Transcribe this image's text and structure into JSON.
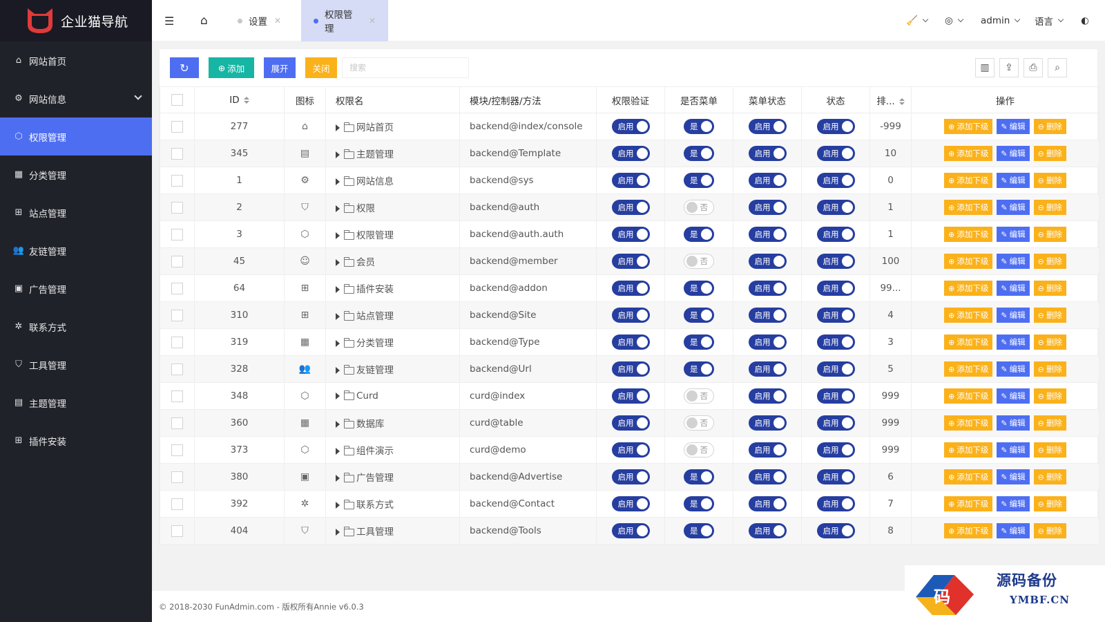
{
  "app": {
    "title": "企业猫导航"
  },
  "sidebar": {
    "items": [
      {
        "label": "网站首页",
        "icon": "home-icon",
        "glyph": "⌂"
      },
      {
        "label": "网站信息",
        "icon": "gear-icon",
        "glyph": "⚙",
        "expandable": true
      },
      {
        "label": "权限管理",
        "icon": "cube-icon",
        "glyph": "⬡",
        "active": true
      },
      {
        "label": "分类管理",
        "icon": "apps-icon",
        "glyph": "▦"
      },
      {
        "label": "站点管理",
        "icon": "windows-icon",
        "glyph": "⊞"
      },
      {
        "label": "友链管理",
        "icon": "users-icon",
        "glyph": "👥"
      },
      {
        "label": "广告管理",
        "icon": "picture-icon",
        "glyph": "▣"
      },
      {
        "label": "联系方式",
        "icon": "cog-outline-icon",
        "glyph": "✲"
      },
      {
        "label": "工具管理",
        "icon": "shield-icon",
        "glyph": "⛉"
      },
      {
        "label": "主题管理",
        "icon": "calendar-icon",
        "glyph": "▤"
      },
      {
        "label": "插件安装",
        "icon": "windows-icon",
        "glyph": "⊞"
      }
    ]
  },
  "header": {
    "tabs": [
      {
        "label": "设置",
        "active": false
      },
      {
        "label": "权限管理",
        "active": true
      }
    ],
    "user": "admin",
    "language": "语言"
  },
  "toolbar": {
    "add_label": "添加",
    "expand_label": "展开",
    "close_label": "关闭",
    "search_placeholder": "搜索"
  },
  "table": {
    "headers": {
      "id": "ID",
      "icon": "图标",
      "name": "权限名",
      "path": "模块/控制器/方法",
      "auth": "权限验证",
      "is_menu": "是否菜单",
      "menu_status": "菜单状态",
      "status": "状态",
      "sort": "排...",
      "ops": "操作"
    },
    "switch_on": "启用",
    "yes": "是",
    "no": "否",
    "actions": {
      "add_child": "添加下级",
      "edit": "编辑",
      "delete": "删除"
    },
    "rows": [
      {
        "id": "277",
        "icon": "home-icon",
        "glyph": "⌂",
        "name": "网站首页",
        "path": "backend@index/console",
        "menu": true,
        "sort": "-999"
      },
      {
        "id": "345",
        "icon": "calendar-icon",
        "glyph": "▤",
        "name": "主题管理",
        "path": "backend@Template",
        "menu": true,
        "sort": "10"
      },
      {
        "id": "1",
        "icon": "gear-icon",
        "glyph": "⚙",
        "name": "网站信息",
        "path": "backend@sys",
        "menu": true,
        "sort": "0"
      },
      {
        "id": "2",
        "icon": "shield-icon",
        "glyph": "⛉",
        "name": "权限",
        "path": "backend@auth",
        "menu": false,
        "sort": "1"
      },
      {
        "id": "3",
        "icon": "cube-icon",
        "glyph": "⬡",
        "name": "权限管理",
        "path": "backend@auth.auth",
        "menu": true,
        "sort": "1"
      },
      {
        "id": "45",
        "icon": "user-icon",
        "glyph": "☺",
        "name": "会员",
        "path": "backend@member",
        "menu": false,
        "sort": "100"
      },
      {
        "id": "64",
        "icon": "windows-icon",
        "glyph": "⊞",
        "name": "插件安装",
        "path": "backend@addon",
        "menu": true,
        "sort": "99..."
      },
      {
        "id": "310",
        "icon": "windows-icon",
        "glyph": "⊞",
        "name": "站点管理",
        "path": "backend@Site",
        "menu": true,
        "sort": "4"
      },
      {
        "id": "319",
        "icon": "apps-icon",
        "glyph": "▦",
        "name": "分类管理",
        "path": "backend@Type",
        "menu": true,
        "sort": "3"
      },
      {
        "id": "328",
        "icon": "users-icon",
        "glyph": "👥",
        "name": "友链管理",
        "path": "backend@Url",
        "menu": true,
        "sort": "5"
      },
      {
        "id": "348",
        "icon": "cube-icon",
        "glyph": "⬡",
        "name": "Curd",
        "path": "curd@index",
        "menu": false,
        "sort": "999"
      },
      {
        "id": "360",
        "icon": "apps-icon",
        "glyph": "▦",
        "name": "数据库",
        "path": "curd@table",
        "menu": false,
        "sort": "999"
      },
      {
        "id": "373",
        "icon": "cube-icon",
        "glyph": "⬡",
        "name": "组件演示",
        "path": "curd@demo",
        "menu": false,
        "sort": "999"
      },
      {
        "id": "380",
        "icon": "picture-icon",
        "glyph": "▣",
        "name": "广告管理",
        "path": "backend@Advertise",
        "menu": true,
        "sort": "6"
      },
      {
        "id": "392",
        "icon": "cog-outline-icon",
        "glyph": "✲",
        "name": "联系方式",
        "path": "backend@Contact",
        "menu": true,
        "sort": "7"
      },
      {
        "id": "404",
        "icon": "shield-icon",
        "glyph": "⛉",
        "name": "工具管理",
        "path": "backend@Tools",
        "menu": true,
        "sort": "8"
      }
    ]
  },
  "footer": {
    "text": "© 2018-2030 FunAdmin.com - 版权所有Annie v6.0.3"
  },
  "watermark": {
    "line1": "源码备份",
    "line2": "YMBF.CN",
    "logo_char": "码"
  },
  "colors": {
    "primary": "#4e6ef2",
    "teal": "#16b5a4",
    "warning": "#fbb11a",
    "sidebar": "#20222a",
    "switch": "#263ea0"
  }
}
